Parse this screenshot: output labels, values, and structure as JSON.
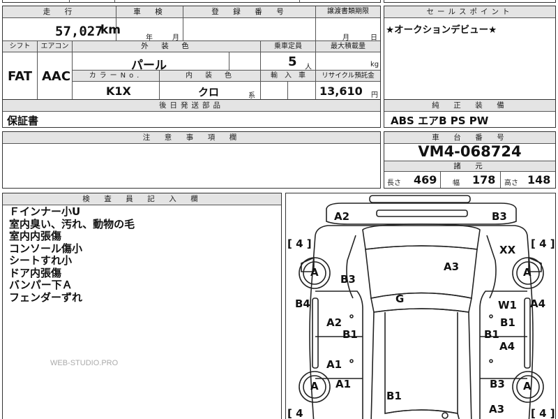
{
  "top_row": {
    "left_tab": "",
    "mid_tab": "",
    "partial": ""
  },
  "row1": {
    "mileage_label": "走　行",
    "mileage_value": "57,027",
    "mileage_unit": "km",
    "inspection_label": "車　検",
    "inspection_year": "年",
    "inspection_month": "月",
    "registration_label": "登　録　番　号",
    "transfer_label": "譲渡書類期限",
    "transfer_month": "月",
    "transfer_day": "日"
  },
  "sales_point": {
    "label": "セールスポイント",
    "text": "★オークションデビュー★"
  },
  "row2": {
    "shift_label": "シフト",
    "shift_value": "FAT",
    "ac_label": "エアコン",
    "ac_value": "AAC",
    "ext_color_label": "外　装　色",
    "ext_color_value": "パール",
    "capacity_label": "乗車定員",
    "capacity_value": "5",
    "capacity_unit": "人",
    "max_load_label": "最大積載量",
    "max_load_unit": "kg",
    "color_no_label": "カラーNo.",
    "color_no_value": "K1X",
    "int_color_label": "内　装　色",
    "int_color_value": "クロ",
    "int_color_suffix": "系",
    "import_label": "輸　入　車",
    "recycle_label": "リサイクル預託金",
    "recycle_value": "13,610",
    "recycle_unit": "円"
  },
  "delivery": {
    "label": "後日発送部品",
    "text": "保証書"
  },
  "equipment": {
    "label": "純　正　装　備",
    "text": "ABS エアB PS PW"
  },
  "caution": {
    "label": "注　意　事　項　欄"
  },
  "chassis": {
    "label": "車　台　番　号",
    "value": "VM4-068724"
  },
  "dimensions": {
    "label": "諸　元",
    "length_label": "長さ",
    "length_value": "469",
    "width_label": "幅",
    "width_value": "178",
    "height_label": "高さ",
    "height_value": "148"
  },
  "inspector": {
    "label": "検　査　員　記　入　欄",
    "notes": [
      "Ｆインナー小U",
      "室内臭い、汚れ、動物の毛",
      "室内内張傷",
      "コンソール傷小",
      "シートすれ小",
      "ドア内張傷",
      "バンパー下Ａ",
      "フェンダーずれ"
    ]
  },
  "diagram": {
    "codes": [
      "A2",
      "B3",
      "XX",
      "A3",
      "B3",
      "G",
      "B4",
      "A4",
      "W1",
      "A2",
      "B1",
      "B1",
      "B1",
      "A4",
      "A1",
      "A1",
      "B3",
      "B1",
      "A3"
    ],
    "tyre_grade": "A",
    "tread": [
      "[ 4 ]",
      "[ 4 ]",
      "[ 4",
      "[ 4 ]"
    ]
  },
  "watermark": "WEB-STUDIO.PRO"
}
